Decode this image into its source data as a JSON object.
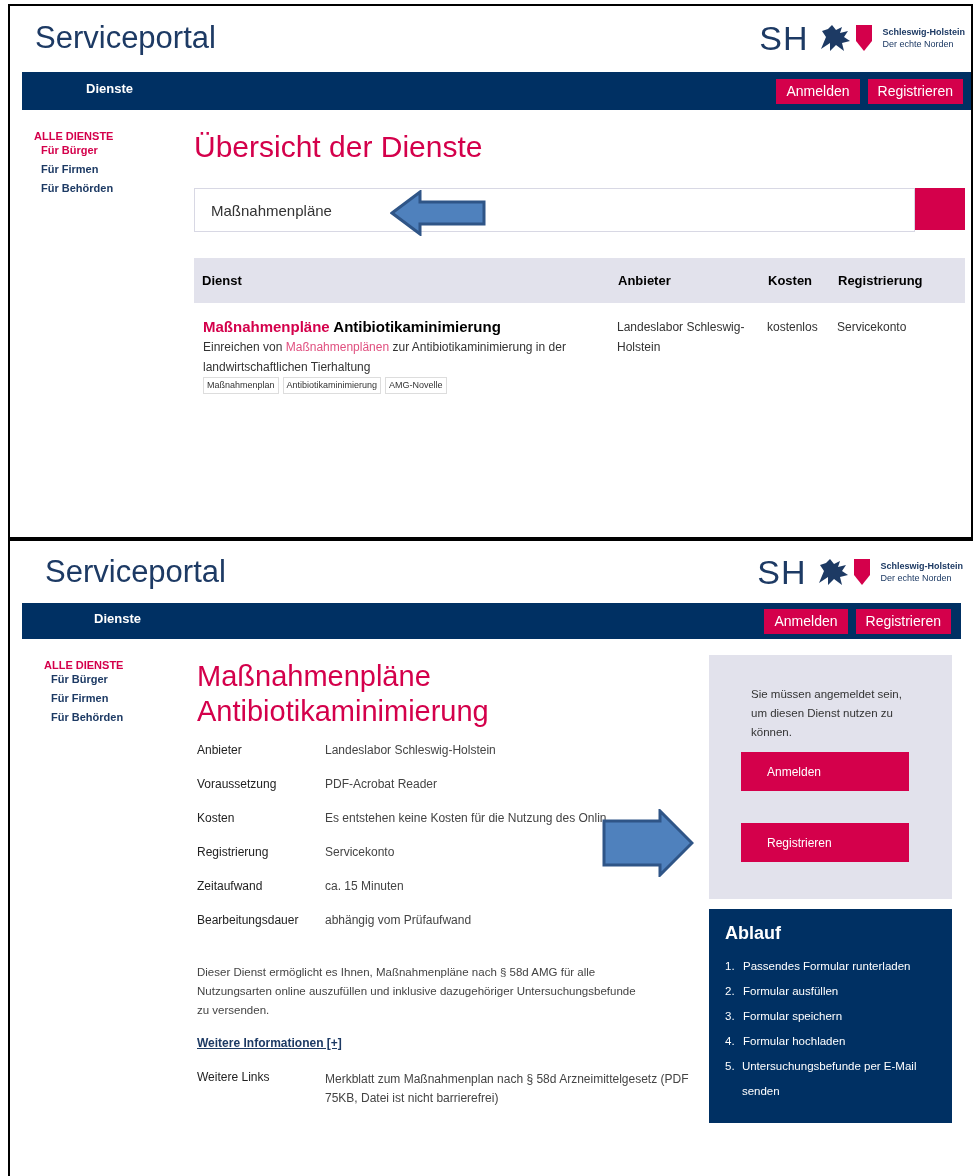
{
  "overview_screen": {
    "header": {
      "title": "Serviceportal",
      "logo_letters": "SH",
      "logo_line_1": "Schleswig-Holstein",
      "logo_line_2": "Der echte Norden"
    },
    "navbar": {
      "menu": "Dienste",
      "buttons": [
        "Anmelden",
        "Registrieren"
      ]
    },
    "sidebar": {
      "heading": "ALLE DIENSTE",
      "items": [
        {
          "label": "Für Bürger",
          "selected": true
        },
        {
          "label": "Für Firmen",
          "selected": false
        },
        {
          "label": "Für Behörden",
          "selected": false
        }
      ]
    },
    "heading": "Übersicht der Dienste",
    "search": {
      "value": "Maßnahmenpläne"
    },
    "table": {
      "columns": [
        "Dienst",
        "Anbieter",
        "Kosten",
        "Registrierung"
      ],
      "rows": [
        {
          "title": [
            {
              "text": "Maßnahmenpläne",
              "highlight": true
            },
            {
              "text": " Antibiotikaminimierung",
              "highlight": false
            }
          ],
          "description": [
            {
              "text": "Einreichen von ",
              "highlight": false
            },
            {
              "text": "Maßnahmenplänen",
              "highlight": true
            },
            {
              "text": " zur Antibiotikaminimierung in der landwirtschaftlichen Tierhaltung",
              "highlight": false
            }
          ],
          "tags": [
            "Maßnahmenplan",
            "Antibiotikaminimierung",
            "AMG-Novelle"
          ],
          "anbieter": "Landeslabor Schleswig-Holstein",
          "kosten": "kostenlos",
          "registrierung": "Servicekonto"
        }
      ]
    }
  },
  "detail_screen": {
    "header": {
      "title": "Serviceportal",
      "logo_letters": "SH",
      "logo_line_1": "Schleswig-Holstein",
      "logo_line_2": "Der echte Norden"
    },
    "navbar": {
      "menu": "Dienste",
      "buttons": [
        "Anmelden",
        "Registrieren"
      ]
    },
    "sidebar": {
      "heading": "ALLE DIENSTE",
      "items": [
        {
          "label": "Für Bürger",
          "selected": false
        },
        {
          "label": "Für Firmen",
          "selected": false
        },
        {
          "label": "Für Behörden",
          "selected": false
        }
      ]
    },
    "title": "Maßnahmenpläne Antibiotikaminimierung",
    "facts": [
      {
        "label": "Anbieter",
        "value": "Landeslabor Schleswig-Holstein"
      },
      {
        "label": "Voraussetzung",
        "value": "PDF-Acrobat Reader"
      },
      {
        "label": "Kosten",
        "value": "Es entstehen keine Kosten für die Nutzung des Onlin"
      },
      {
        "label": "Registrierung",
        "value": "Servicekonto"
      },
      {
        "label": "Zeitaufwand",
        "value": "ca. 15 Minuten"
      },
      {
        "label": "Bearbeitungsdauer",
        "value": "abhängig vom Prüfaufwand"
      }
    ],
    "description": "Dieser Dienst ermöglicht es Ihnen, Maßnahmenpläne nach § 58d AMG für alle Nutzungsarten online auszufüllen und inklusive dazugehöriger Untersuchungsbefunde zu versenden.",
    "more_link": "Weitere Informationen [+]",
    "links": {
      "label": "Weitere Links",
      "value": "Merkblatt zum Maßnahmenplan nach § 58d Arzneimittelgesetz (PDF 75KB, Datei ist nicht barrierefrei)"
    },
    "login_box": {
      "notice": "Sie müssen angemeldet sein, um diesen Dienst nutzen zu können.",
      "buttons": [
        "Anmelden",
        "Registrieren"
      ]
    },
    "process": {
      "title": "Ablauf",
      "steps": [
        {
          "number": "1.",
          "text": "Passendes Formular runterladen"
        },
        {
          "number": "2.",
          "text": "Formular ausfüllen"
        },
        {
          "number": "3.",
          "text": "Formular speichern"
        },
        {
          "number": "4.",
          "text": "Formular hochladen"
        },
        {
          "number": "5.",
          "text": "Untersuchungsbefunde per E-Mail senden"
        }
      ]
    }
  }
}
